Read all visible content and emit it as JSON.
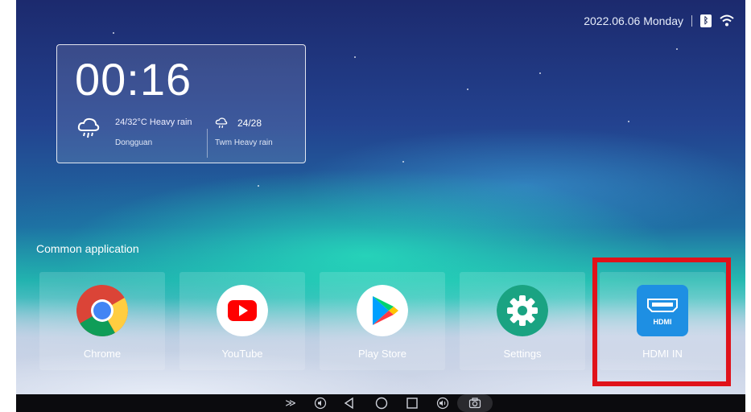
{
  "status": {
    "date": "2022.06.06 Monday",
    "bluetooth_icon": "bluetooth-icon",
    "wifi_icon": "wifi-icon"
  },
  "clock": {
    "time": "00:16",
    "today": {
      "range": "24/32°C Heavy rain",
      "city": "Dongguan",
      "icon": "heavy-rain-icon"
    },
    "tomorrow": {
      "temp": "24/28",
      "desc": "Twm Heavy rain",
      "icon": "rain-cloud-icon"
    }
  },
  "apps_section": {
    "title": "Common application"
  },
  "apps": [
    {
      "label": "Chrome",
      "icon": "chrome-icon"
    },
    {
      "label": "YouTube",
      "icon": "youtube-icon"
    },
    {
      "label": "Play Store",
      "icon": "play-store-icon"
    },
    {
      "label": "Settings",
      "icon": "settings-gear-icon"
    },
    {
      "label": "HDMI IN",
      "icon": "hdmi-icon",
      "badge_text": "HDMI"
    }
  ],
  "navbar": [
    "collapse-icon",
    "volume-down-icon",
    "back-icon",
    "home-icon",
    "recents-icon",
    "volume-up-icon",
    "screenshot-camera-icon"
  ],
  "colors": {
    "highlight": "#e0121a",
    "hdmi_blue": "#1e8fe3",
    "navbar": "#0b0b0e"
  }
}
